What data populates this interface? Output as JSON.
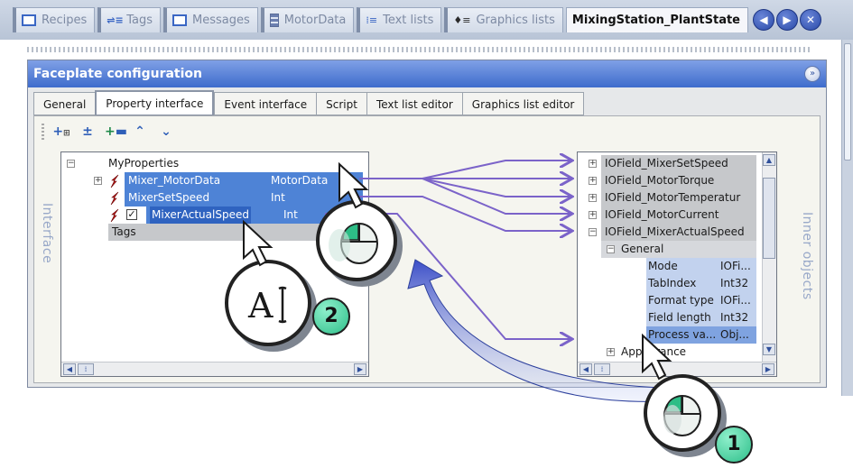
{
  "doc_tabs": [
    {
      "label": "Recipes",
      "icon": "window-icon"
    },
    {
      "label": "Tags",
      "icon": "tags-icon"
    },
    {
      "label": "Messages",
      "icon": "window-icon"
    },
    {
      "label": "MotorData",
      "icon": "database-icon"
    },
    {
      "label": "Text lists",
      "icon": "list-icon"
    },
    {
      "label": "Graphics lists",
      "icon": "list-icon"
    },
    {
      "label": "MixingStation_PlantState",
      "icon": ""
    }
  ],
  "nav": {
    "prev": "◀",
    "next": "▶",
    "close": "✕"
  },
  "panel": {
    "title": "Faceplate configuration",
    "collapse": "»"
  },
  "subtabs": [
    "General",
    "Property interface",
    "Event interface",
    "Script",
    "Text list editor",
    "Graphics list editor"
  ],
  "side_labels": {
    "left": "Interface",
    "right": "Inner objects"
  },
  "interface_tree": {
    "root": "MyProperties",
    "items": [
      {
        "name": "Mixer_MotorData",
        "type": "MotorData"
      },
      {
        "name": "MixerSetSpeed",
        "type": "Int"
      },
      {
        "name": "MixerActualSpeed",
        "type": "Int"
      }
    ],
    "tags_label": "Tags"
  },
  "inner_objects": {
    "fields": [
      "IOField_MixerSetSpeed",
      "IOField_MotorTorque",
      "IOField_MotorTemperatur",
      "IOField_MotorCurrent",
      "IOField_MixerActualSpeed"
    ],
    "group": "General",
    "properties": [
      {
        "name": "Mode",
        "type": "IOFi..."
      },
      {
        "name": "TabIndex",
        "type": "Int32"
      },
      {
        "name": "Format type",
        "type": "IOFi..."
      },
      {
        "name": "Field length",
        "type": "Int32"
      },
      {
        "name": "Process va...",
        "type": "Obj..."
      }
    ],
    "appearance": "Appearance"
  },
  "callouts": {
    "one": "1",
    "two": "2"
  },
  "colors": {
    "accent": "#3e6ccc",
    "selection": "#4e83d6",
    "link": "#7b63c9"
  }
}
